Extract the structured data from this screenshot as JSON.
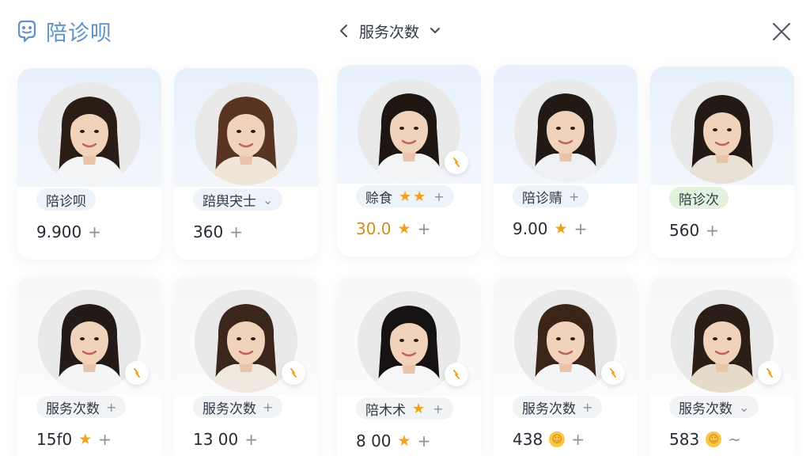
{
  "app": {
    "name": "陪诊呗",
    "logo_icon": "robot-face-icon"
  },
  "sorter": {
    "label": "服务次数",
    "prev_icon": "chevron-left-icon",
    "dropdown_icon": "chevron-down-icon"
  },
  "close": {
    "icon": "close-icon"
  },
  "colors": {
    "brand": "#5f93c7",
    "star": "#f0a21c",
    "tag_bg": "#eef2f9",
    "tag_green_bg": "#e3f2dd"
  },
  "cards": [
    {
      "tag": "陪诊呗",
      "stat": "9.900",
      "action": "+"
    },
    {
      "tag": "踣舆宊士",
      "tag_suffix": "⌄",
      "stat": "360",
      "action": "+"
    },
    {
      "tag": "赊食",
      "tag_stars": "★★",
      "tag_suffix": "+",
      "stat": "30.0",
      "stat_star": "★",
      "action": "+"
    },
    {
      "tag": "陪诊䞍",
      "tag_suffix": "+",
      "stat": "9.00",
      "stat_star": "★",
      "action": "+"
    },
    {
      "tag": "陪诊次",
      "stat": "560",
      "action": "+"
    },
    {
      "tag": "服务次数",
      "tag_suffix": "+",
      "stat": "15f0",
      "stat_star": "★",
      "action": "+"
    },
    {
      "tag": "服务次数",
      "tag_suffix": "+",
      "stat": "13 00",
      "action": "+"
    },
    {
      "tag": "陪木术",
      "tag_stars": "★",
      "tag_suffix": "+",
      "stat": "8 00",
      "stat_star": "★",
      "action": "+"
    },
    {
      "tag": "服务次数",
      "tag_suffix": "+",
      "stat": "438",
      "stat_star": "☺",
      "action": "+"
    },
    {
      "tag": "服务次数",
      "tag_suffix": "⌄",
      "stat": "583",
      "stat_star": "☺",
      "action": "~"
    }
  ]
}
